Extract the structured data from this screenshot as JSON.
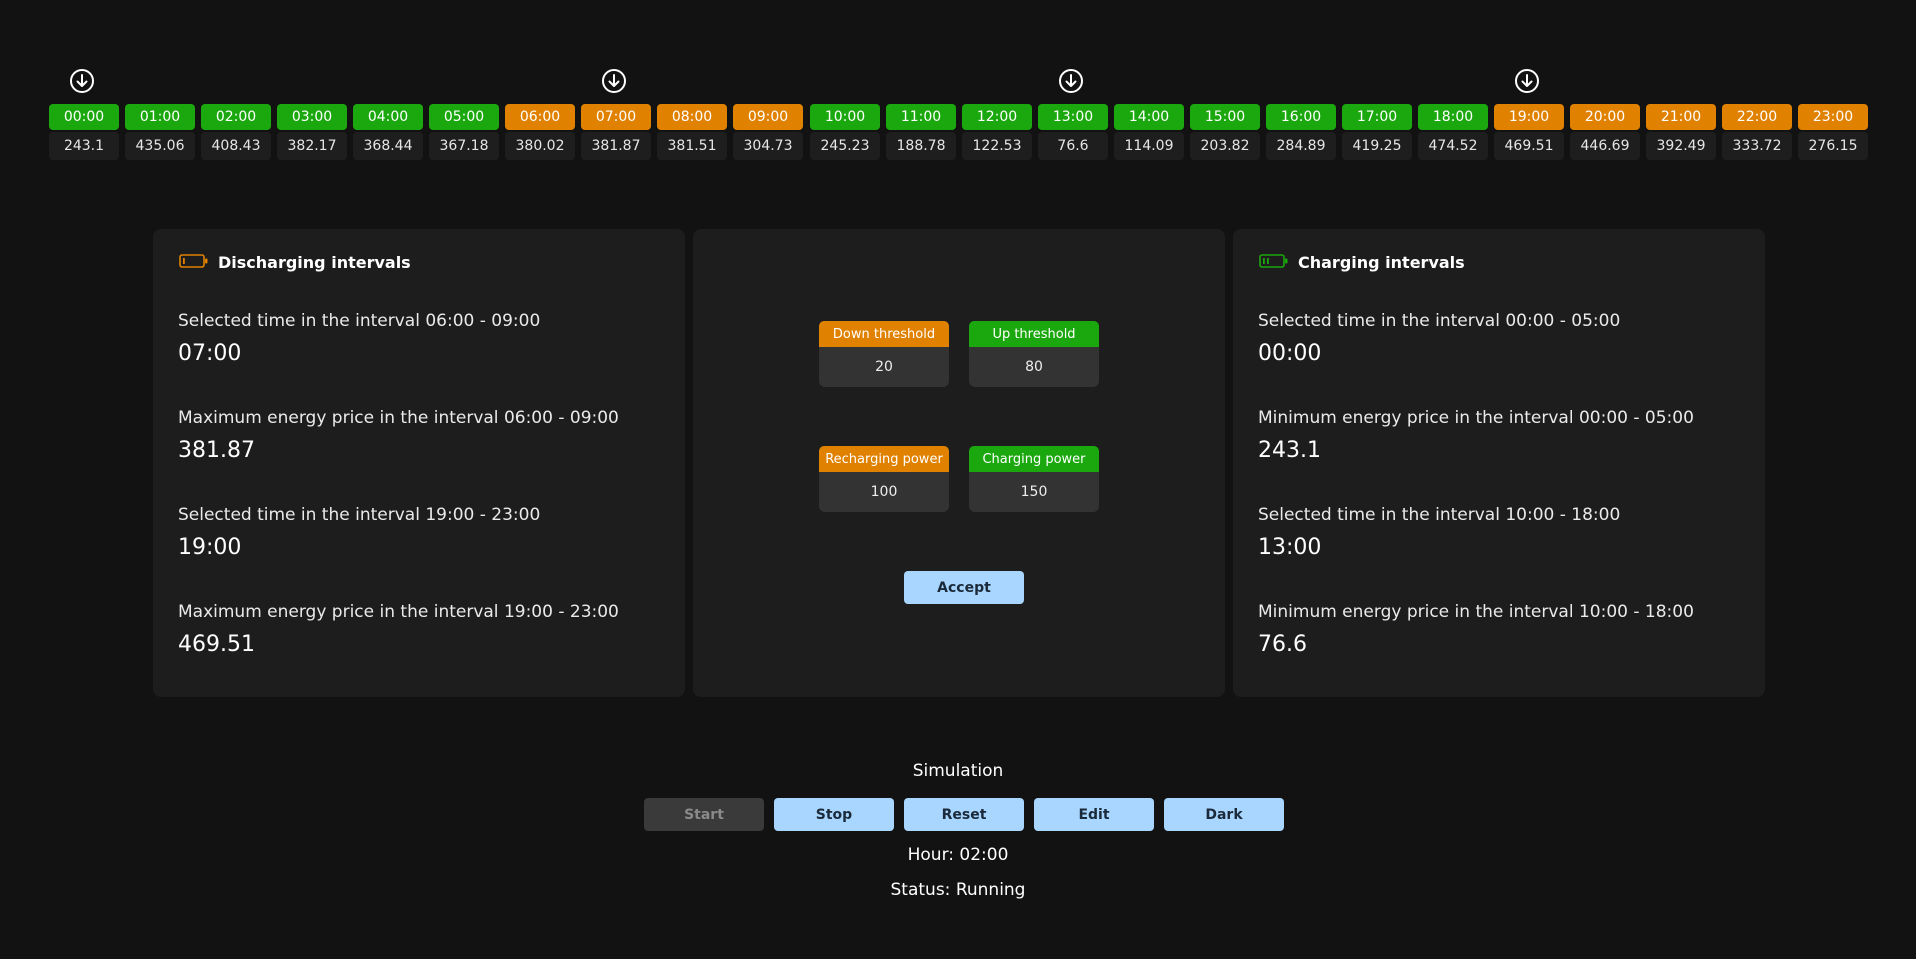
{
  "timeline": [
    {
      "time": "00:00",
      "price": "243.1",
      "type": "green",
      "marked": true
    },
    {
      "time": "01:00",
      "price": "435.06",
      "type": "green",
      "marked": false
    },
    {
      "time": "02:00",
      "price": "408.43",
      "type": "green",
      "marked": false
    },
    {
      "time": "03:00",
      "price": "382.17",
      "type": "green",
      "marked": false
    },
    {
      "time": "04:00",
      "price": "368.44",
      "type": "green",
      "marked": false
    },
    {
      "time": "05:00",
      "price": "367.18",
      "type": "green",
      "marked": false
    },
    {
      "time": "06:00",
      "price": "380.02",
      "type": "orange",
      "marked": false
    },
    {
      "time": "07:00",
      "price": "381.87",
      "type": "orange",
      "marked": true
    },
    {
      "time": "08:00",
      "price": "381.51",
      "type": "orange",
      "marked": false
    },
    {
      "time": "09:00",
      "price": "304.73",
      "type": "orange",
      "marked": false
    },
    {
      "time": "10:00",
      "price": "245.23",
      "type": "green",
      "marked": false
    },
    {
      "time": "11:00",
      "price": "188.78",
      "type": "green",
      "marked": false
    },
    {
      "time": "12:00",
      "price": "122.53",
      "type": "green",
      "marked": false
    },
    {
      "time": "13:00",
      "price": "76.6",
      "type": "green",
      "marked": true
    },
    {
      "time": "14:00",
      "price": "114.09",
      "type": "green",
      "marked": false
    },
    {
      "time": "15:00",
      "price": "203.82",
      "type": "green",
      "marked": false
    },
    {
      "time": "16:00",
      "price": "284.89",
      "type": "green",
      "marked": false
    },
    {
      "time": "17:00",
      "price": "419.25",
      "type": "green",
      "marked": false
    },
    {
      "time": "18:00",
      "price": "474.52",
      "type": "green",
      "marked": false
    },
    {
      "time": "19:00",
      "price": "469.51",
      "type": "orange",
      "marked": true
    },
    {
      "time": "20:00",
      "price": "446.69",
      "type": "orange",
      "marked": false
    },
    {
      "time": "21:00",
      "price": "392.49",
      "type": "orange",
      "marked": false
    },
    {
      "time": "22:00",
      "price": "333.72",
      "type": "orange",
      "marked": false
    },
    {
      "time": "23:00",
      "price": "276.15",
      "type": "orange",
      "marked": false
    }
  ],
  "colors": {
    "charging": "#1ba80e",
    "discharging": "#e08100",
    "background": "#121212",
    "panel": "#1d1d1d",
    "button": "#a9d6ff"
  },
  "discharge": {
    "title": "Discharging intervals",
    "icon": "battery-low-icon",
    "items": [
      {
        "label": "Selected time in the interval 06:00 - 09:00",
        "value": "07:00"
      },
      {
        "label": "Maximum energy price in the interval 06:00 - 09:00",
        "value": "381.87"
      },
      {
        "label": "Selected time in the interval 19:00 - 23:00",
        "value": "19:00"
      },
      {
        "label": "Maximum energy price in the interval 19:00 - 23:00",
        "value": "469.51"
      }
    ]
  },
  "charge": {
    "title": "Charging intervals",
    "icon": "battery-charging-icon",
    "items": [
      {
        "label": "Selected time in the interval 00:00 - 05:00",
        "value": "00:00"
      },
      {
        "label": "Minimum energy price in the interval 00:00 - 05:00",
        "value": "243.1"
      },
      {
        "label": "Selected time in the interval 10:00 - 18:00",
        "value": "13:00"
      },
      {
        "label": "Minimum energy price in the interval 10:00 - 18:00",
        "value": "76.6"
      }
    ]
  },
  "settings": {
    "down_threshold": {
      "label": "Down threshold",
      "value": "20"
    },
    "up_threshold": {
      "label": "Up threshold",
      "value": "80"
    },
    "recharging_power": {
      "label": "Recharging power",
      "value": "100"
    },
    "charging_power": {
      "label": "Charging power",
      "value": "150"
    },
    "accept_label": "Accept"
  },
  "simulation": {
    "title": "Simulation",
    "buttons": {
      "start": "Start",
      "stop": "Stop",
      "reset": "Reset",
      "edit": "Edit",
      "dark": "Dark"
    },
    "start_disabled": true,
    "hour": "Hour: 02:00",
    "status": "Status: Running"
  }
}
